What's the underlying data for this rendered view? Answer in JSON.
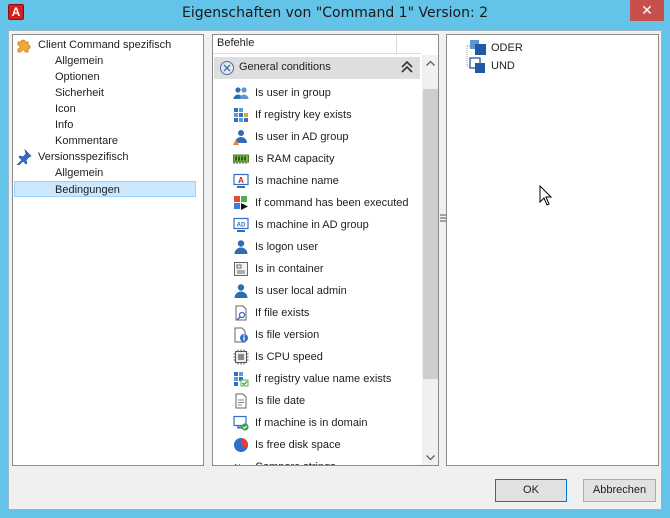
{
  "window": {
    "title": "Eigenschaften von \"Command 1\" Version: 2",
    "app_badge": "A",
    "close_glyph": "✕"
  },
  "tree": {
    "groups": [
      {
        "label": "Client Command spezifisch",
        "icon": "puzzle-icon",
        "children": [
          "Allgemein",
          "Optionen",
          "Sicherheit",
          "Icon",
          "Info",
          "Kommentare"
        ]
      },
      {
        "label": "Versionsspezifisch",
        "icon": "pin-icon",
        "children": [
          "Allgemein",
          "Bedingungen"
        ]
      }
    ],
    "selected": "Bedingungen"
  },
  "commands": {
    "column_header": "Befehle",
    "group_label": "General conditions",
    "items": [
      {
        "label": "Is user in group",
        "icon": "user-group-icon"
      },
      {
        "label": "If registry key exists",
        "icon": "registry-icon"
      },
      {
        "label": "Is user in AD group",
        "icon": "ad-user-icon"
      },
      {
        "label": "Is RAM capacity",
        "icon": "ram-icon"
      },
      {
        "label": "Is machine name",
        "icon": "machine-name-icon"
      },
      {
        "label": "If command has been executed",
        "icon": "command-executed-icon"
      },
      {
        "label": "Is machine in AD group",
        "icon": "ad-machine-icon"
      },
      {
        "label": "Is logon user",
        "icon": "logon-user-icon"
      },
      {
        "label": "Is in container",
        "icon": "container-icon"
      },
      {
        "label": "Is user local admin",
        "icon": "local-admin-icon"
      },
      {
        "label": "If file exists",
        "icon": "file-search-icon"
      },
      {
        "label": "Is file version",
        "icon": "file-info-icon"
      },
      {
        "label": "Is CPU speed",
        "icon": "cpu-icon"
      },
      {
        "label": "If registry value name exists",
        "icon": "registry-value-icon"
      },
      {
        "label": "Is file date",
        "icon": "file-date-icon"
      },
      {
        "label": "If machine is in domain",
        "icon": "domain-machine-icon"
      },
      {
        "label": "Is free disk space",
        "icon": "disk-space-icon"
      },
      {
        "label": "Compare strings",
        "icon": "compare-strings-icon"
      }
    ]
  },
  "logic": {
    "nodes": [
      {
        "label": "ODER",
        "icon": "or-block-icon"
      },
      {
        "label": "UND",
        "icon": "and-block-icon"
      }
    ]
  },
  "buttons": {
    "ok": "OK",
    "cancel": "Abbrechen"
  },
  "colors": {
    "titlebar": "#63c3e8",
    "selection": "#cce8ff",
    "group_header": "#dedede",
    "close": "#c7504d"
  }
}
